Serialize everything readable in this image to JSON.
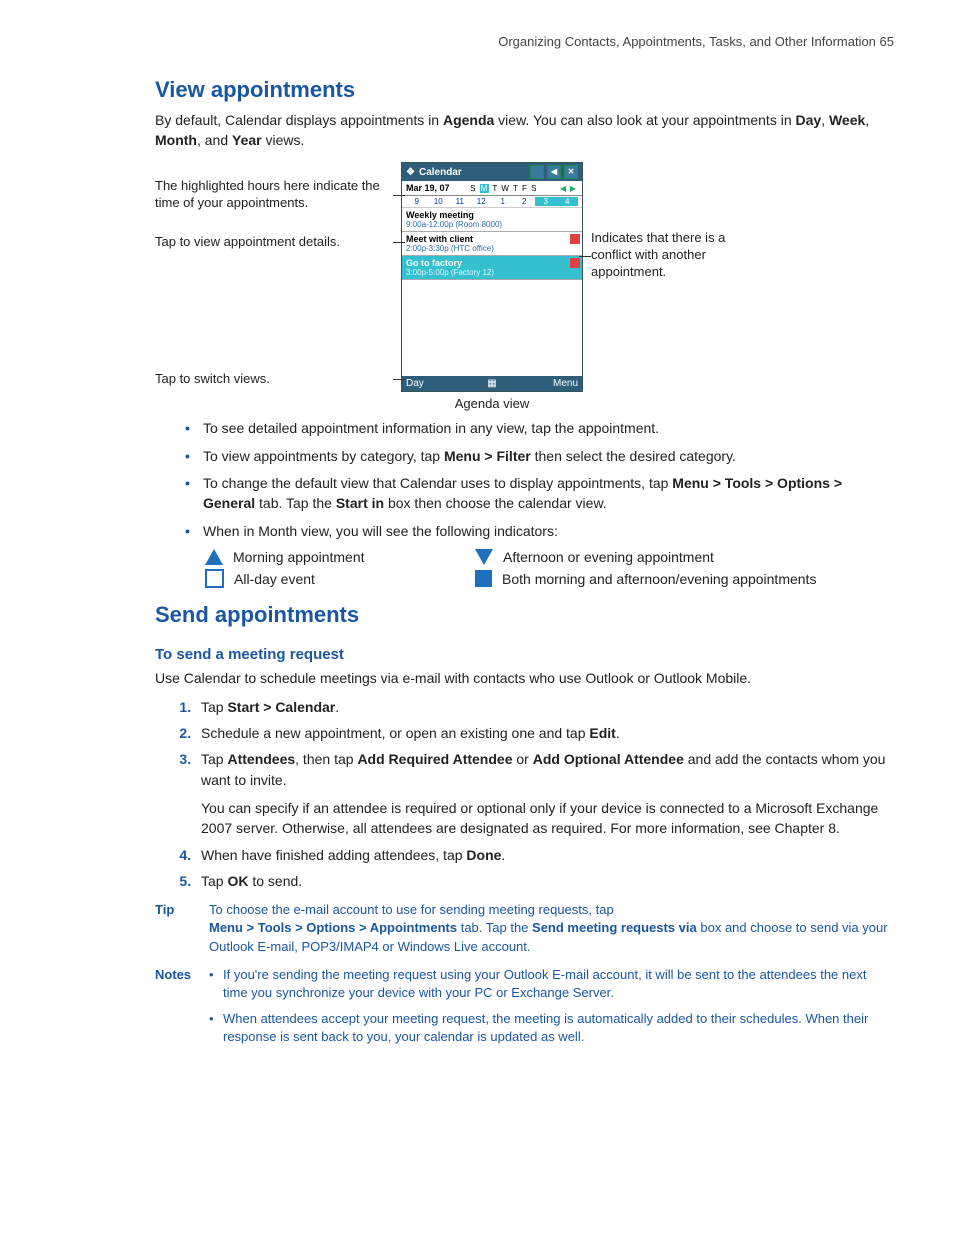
{
  "running_head": "Organizing Contacts, Appointments, Tasks, and Other Information  65",
  "section1": {
    "title": "View appointments",
    "intro_pre": "By default, Calendar displays appointments in ",
    "intro_b1": "Agenda",
    "intro_mid1": " view. You can also look at your appointments in ",
    "intro_b2": "Day",
    "intro_c1": ", ",
    "intro_b3": "Week",
    "intro_c2": ", ",
    "intro_b4": "Month",
    "intro_c3": ", and ",
    "intro_b5": "Year",
    "intro_post": " views."
  },
  "callouts": {
    "left1": "The highlighted hours here indicate the time of your appointments.",
    "left2": "Tap to view appointment details.",
    "left3": "Tap to switch views.",
    "right1": "Indicates that there is a conflict with another appointment."
  },
  "phone": {
    "title": "Calendar",
    "close": "✕",
    "date": "Mar 19, 07",
    "days_pre": "S ",
    "days_sel": "M",
    "days_post": " T W T F S",
    "nums": [
      "9",
      "10",
      "11",
      "12",
      "1",
      "2",
      "3",
      "4"
    ],
    "appt1_t": "Weekly meeting",
    "appt1_s": "9:00a-12:00p  (Room 8000)",
    "appt2_t": "Meet with client",
    "appt2_s": "2:00p-3:30p  (HTC office)",
    "appt3_t": "Go to factory",
    "appt3_s": "3:00p-5:00p  (Factory 12)",
    "foot_left": "Day",
    "foot_mid": "▦",
    "foot_right": "Menu",
    "caption": "Agenda view"
  },
  "bullets": {
    "b1": "To see detailed appointment information in any view, tap the appointment.",
    "b2_pre": "To view appointments by category, tap ",
    "b2_b": "Menu > Filter",
    "b2_post": " then select the desired category.",
    "b3_pre": "To change the default view that Calendar uses to display appointments, tap ",
    "b3_b1": "Menu > Tools > Options > General",
    "b3_mid": " tab. Tap the ",
    "b3_b2": "Start in",
    "b3_post": " box then choose the calendar view.",
    "b4": "When in Month view, you will see the following indicators:"
  },
  "indicators": {
    "i1": "Morning appointment",
    "i2": "Afternoon or evening appointment",
    "i3": "All-day event",
    "i4": "Both morning and afternoon/evening appointments"
  },
  "section2": {
    "title": "Send appointments",
    "sub": "To send a meeting request",
    "intro": "Use Calendar to schedule meetings via e-mail with contacts who use Outlook or Outlook Mobile."
  },
  "steps": {
    "s1_pre": "Tap ",
    "s1_b": "Start > Calendar",
    "s1_post": ".",
    "s2_pre": "Schedule a new appointment, or open an existing one and tap ",
    "s2_b": "Edit",
    "s2_post": ".",
    "s3_pre": "Tap ",
    "s3_b1": "Attendees",
    "s3_mid1": ", then tap ",
    "s3_b2": "Add Required Attendee",
    "s3_mid2": " or ",
    "s3_b3": "Add Optional Attendee",
    "s3_post": " and add the contacts whom you want to invite.",
    "s3_p2": "You can specify if an attendee is required or optional only if your device is connected to a Microsoft Exchange 2007 server. Otherwise, all attendees are designated as required. For more information, see Chapter 8.",
    "s4_pre": "When have finished adding attendees, tap ",
    "s4_b": "Done",
    "s4_post": ".",
    "s5_pre": "Tap ",
    "s5_b": "OK",
    "s5_post": " to send."
  },
  "tip": {
    "label": "Tip",
    "line1": "To choose the e-mail account to use for sending meeting requests, tap ",
    "b1": "Menu > Tools > Options > Appointments",
    "mid1": " tab. Tap the ",
    "b2": "Send meeting requests via",
    "post": " box and choose to send via your Outlook E-mail, POP3/IMAP4 or Windows Live account."
  },
  "notes": {
    "label": "Notes",
    "n1": "If you're sending the meeting request using your Outlook E-mail account, it will be sent to the attendees the next time you synchronize your device with your PC or Exchange Server.",
    "n2": "When attendees accept your meeting request, the meeting is automatically added to their schedules. When their response is sent back to you, your calendar is updated as well."
  }
}
